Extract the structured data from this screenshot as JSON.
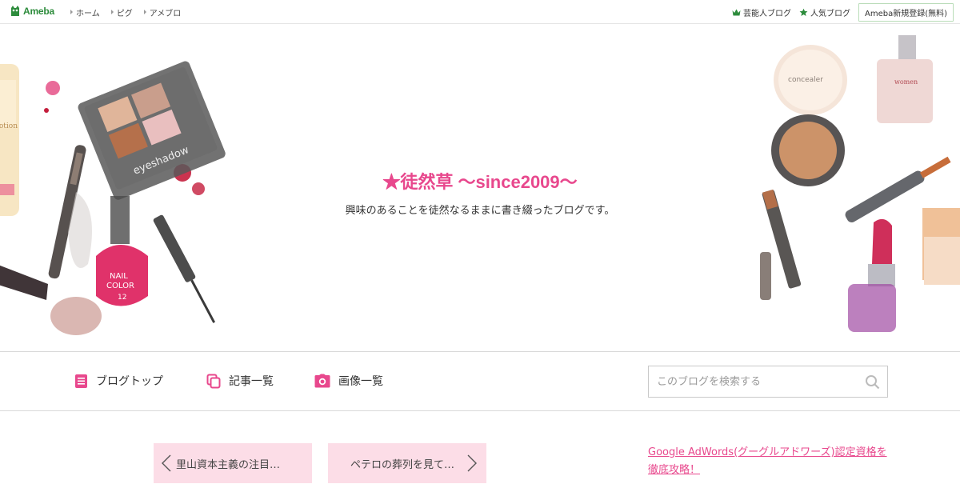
{
  "topbar": {
    "logo_text": "Ameba",
    "nav": [
      {
        "label": "ホーム"
      },
      {
        "label": "ピグ"
      },
      {
        "label": "アメブロ"
      }
    ],
    "right_links": [
      {
        "label": "芸能人ブログ",
        "icon": "crown-icon"
      },
      {
        "label": "人気ブログ",
        "icon": "star-icon"
      }
    ],
    "signup_label": "Ameba新規登録(無料)"
  },
  "header": {
    "title": "★徒然草 ～since2009～",
    "description": "興味のあることを徒然なるままに書き綴ったブログです。",
    "art_text": {
      "eyeshadow": "eyeshadow",
      "nail_line1": "NAIL",
      "nail_line2": "COLOR",
      "nail_number": "12",
      "perfume": "women",
      "compact": "concealer"
    }
  },
  "nav": {
    "items": [
      {
        "label": "ブログトップ",
        "icon": "document-icon"
      },
      {
        "label": "記事一覧",
        "icon": "copy-icon"
      },
      {
        "label": "画像一覧",
        "icon": "camera-icon"
      }
    ],
    "search_placeholder": "このブログを検索する"
  },
  "pager": {
    "prev_label": "里山資本主義の注目…",
    "next_label": "ペテロの葬列を見て…"
  },
  "ad": {
    "link_text": "Google AdWords(グーグルアドワーズ)認定資格を徹底攻略！"
  },
  "colors": {
    "accent": "#e8488d",
    "ameba_green": "#2d8c3c",
    "pager_bg": "#fcdde7"
  }
}
